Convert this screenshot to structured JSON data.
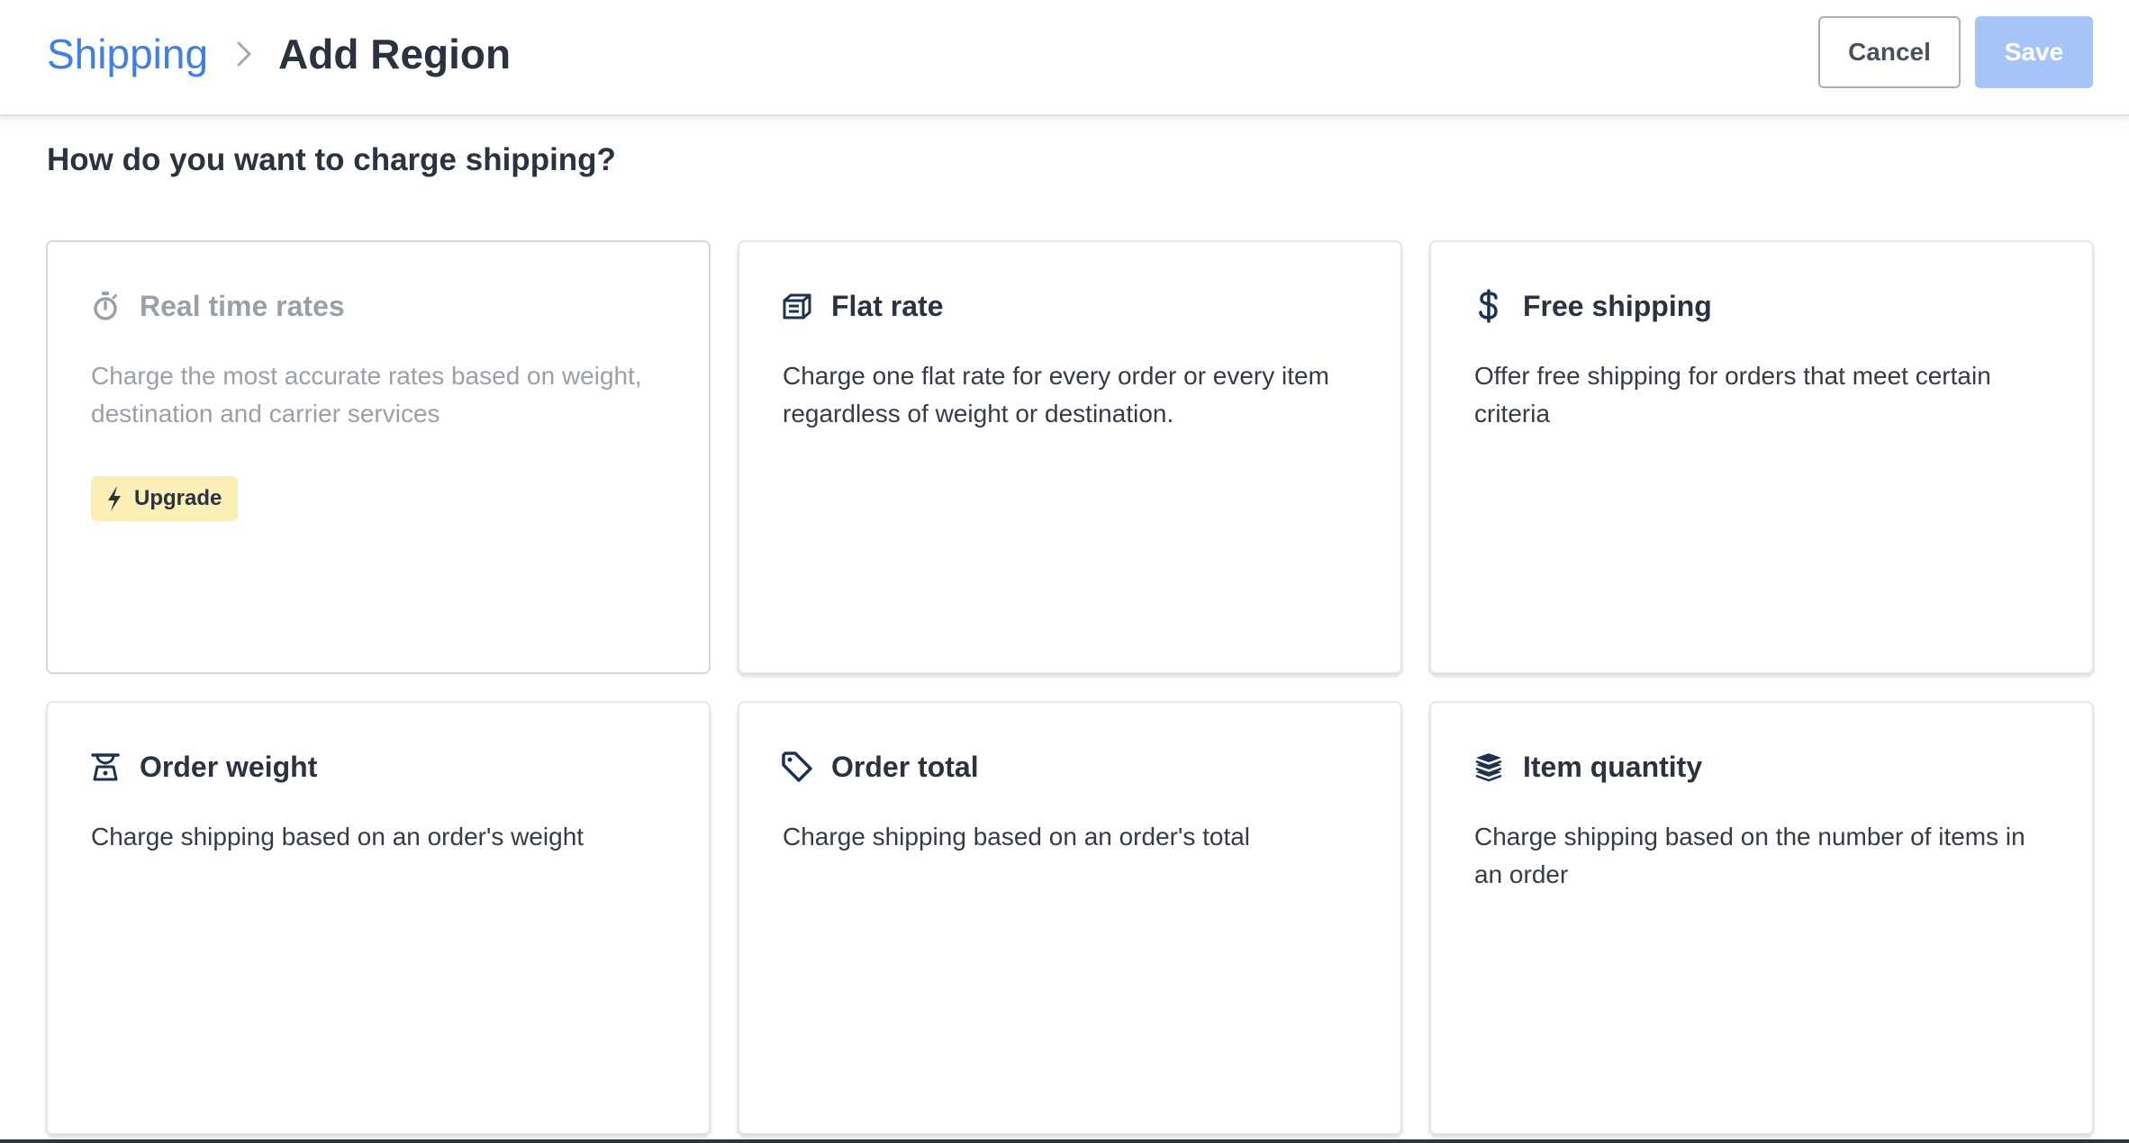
{
  "header": {
    "breadcrumb_parent": "Shipping",
    "breadcrumb_current": "Add Region",
    "cancel_label": "Cancel",
    "save_label": "Save"
  },
  "question": "How do you want to charge shipping?",
  "options": [
    {
      "title": "Real time rates",
      "description": "Charge the most accurate rates based on weight, destination and carrier services",
      "icon": "stopwatch-icon",
      "disabled": true,
      "badge": "Upgrade",
      "badge_icon": "lightning-bolt-icon"
    },
    {
      "title": "Flat rate",
      "description": "Charge one flat rate for every order or every item regardless of weight or destination.",
      "icon": "box-icon"
    },
    {
      "title": "Free shipping",
      "description": "Offer free shipping for orders that meet certain criteria",
      "icon": "dollar-icon"
    },
    {
      "title": "Order weight",
      "description": "Charge shipping based on an order's weight",
      "icon": "scale-icon"
    },
    {
      "title": "Order total",
      "description": "Charge shipping based on an order's total",
      "icon": "tag-icon"
    },
    {
      "title": "Item quantity",
      "description": "Charge shipping based on the number of items in an order",
      "icon": "stack-icon"
    }
  ],
  "colors": {
    "link": "#3f7fe6",
    "save_disabled": "#a5c4f8",
    "icon_navy": "#1d3251",
    "badge_bg": "#fcefb6",
    "disabled_text": "#9aa0a8"
  }
}
